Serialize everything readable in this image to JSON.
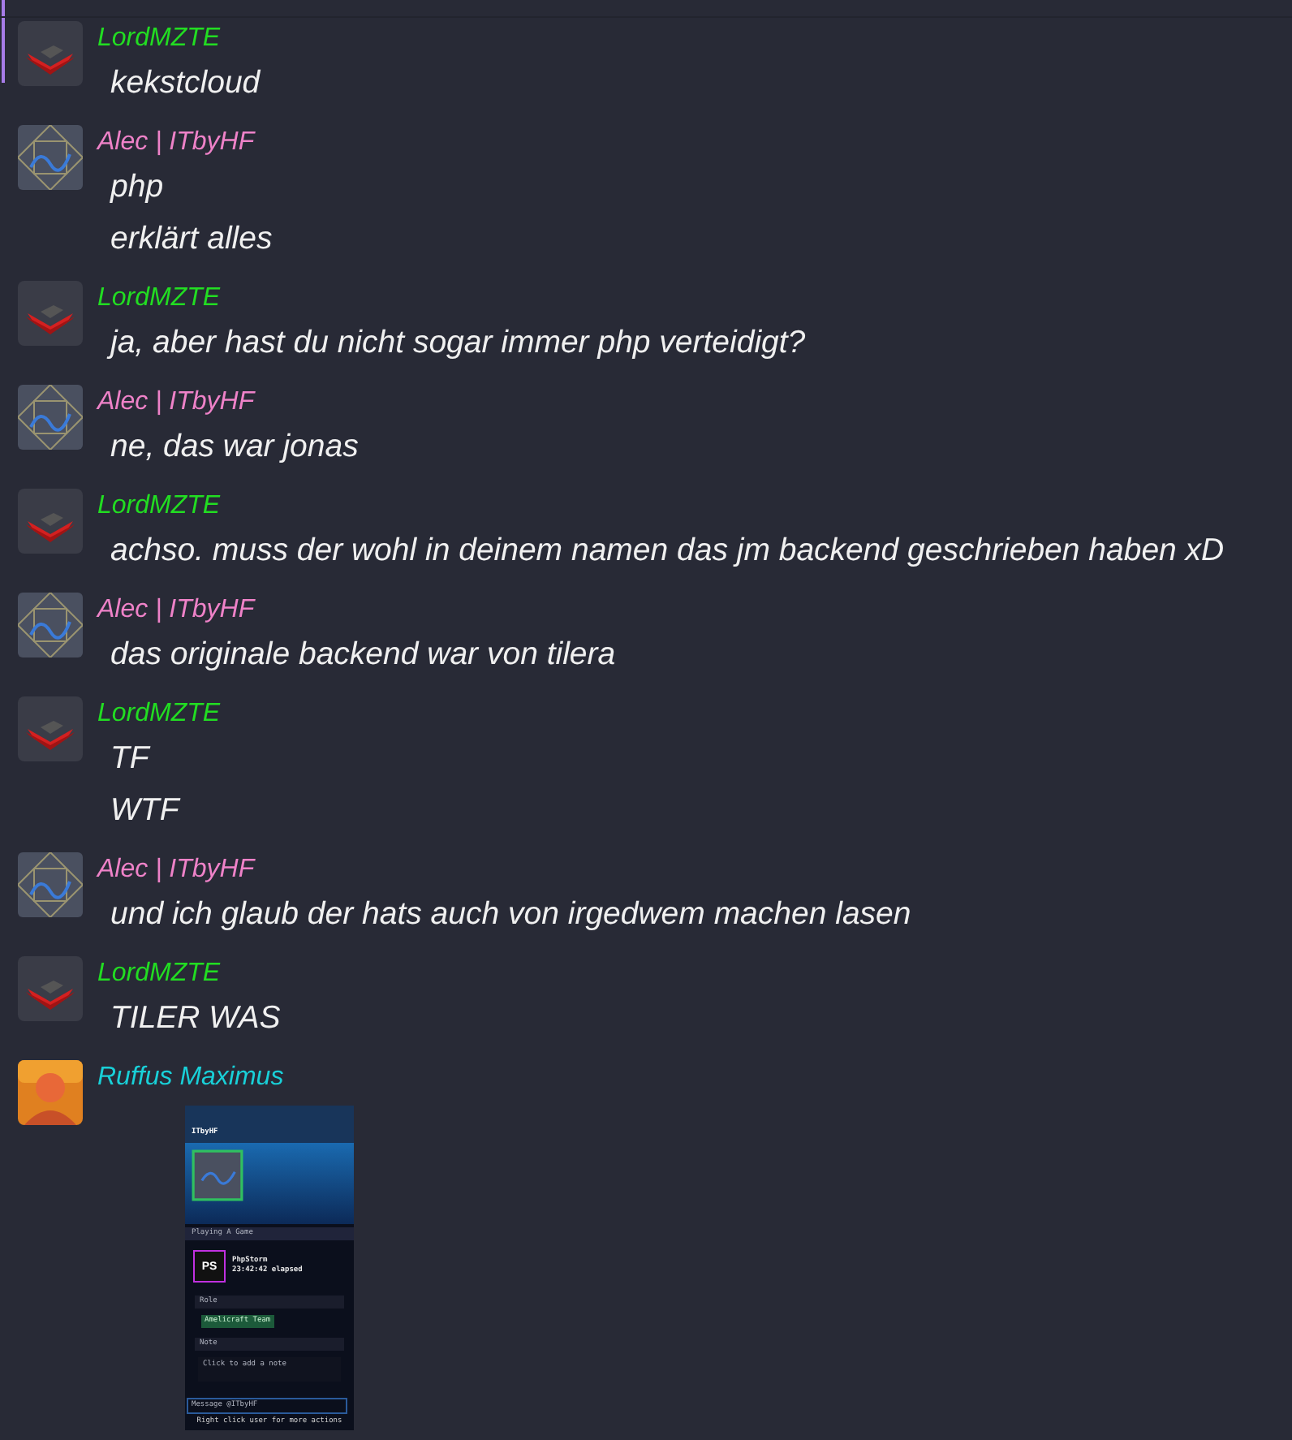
{
  "messages": [
    {
      "author": "LordMZTE",
      "color": "#22dd22",
      "avatar": {
        "kind": "tile"
      },
      "lines": [
        "kekstcloud"
      ]
    },
    {
      "author": "Alec | ITbyHF",
      "color": "#ee82c8",
      "avatar": {
        "kind": "pattern"
      },
      "lines": [
        "php",
        "erklärt alles"
      ]
    },
    {
      "author": "LordMZTE",
      "color": "#22dd22",
      "avatar": {
        "kind": "tile"
      },
      "lines": [
        "ja, aber hast du nicht sogar immer php verteidigt?"
      ]
    },
    {
      "author": "Alec | ITbyHF",
      "color": "#ee82c8",
      "avatar": {
        "kind": "pattern"
      },
      "lines": [
        "ne, das war jonas"
      ]
    },
    {
      "author": "LordMZTE",
      "color": "#22dd22",
      "avatar": {
        "kind": "tile"
      },
      "lines": [
        "achso. muss der wohl in deinem namen das jm backend geschrieben haben xD"
      ]
    },
    {
      "author": "Alec | ITbyHF",
      "color": "#ee82c8",
      "avatar": {
        "kind": "pattern"
      },
      "lines": [
        "das originale backend war von tilera"
      ]
    },
    {
      "author": "LordMZTE",
      "color": "#22dd22",
      "avatar": {
        "kind": "tile"
      },
      "lines": [
        "TF",
        "WTF"
      ]
    },
    {
      "author": "Alec | ITbyHF",
      "color": "#ee82c8",
      "avatar": {
        "kind": "pattern"
      },
      "lines": [
        "und ich glaub der hats auch von irgedwem machen lasen"
      ]
    },
    {
      "author": "LordMZTE",
      "color": "#22dd22",
      "avatar": {
        "kind": "tile"
      },
      "lines": [
        "TILER WAS"
      ]
    },
    {
      "author": "Ruffus Maximus",
      "color": "#19d0d8",
      "avatar": {
        "kind": "photo"
      },
      "attachment": {
        "kind": "screenshot",
        "username": "ITbyHF",
        "activity_header": "Playing A Game",
        "app_icon": "PS",
        "app_name": "PhpStorm",
        "elapsed": "23:42:42 elapsed",
        "role_header": "Role",
        "role": "Amelicraft Team",
        "note_header": "Note",
        "note_placeholder": "Click to add a note",
        "message_placeholder": "Message @ITbyHF",
        "hint": "Right click user for more actions"
      }
    }
  ]
}
